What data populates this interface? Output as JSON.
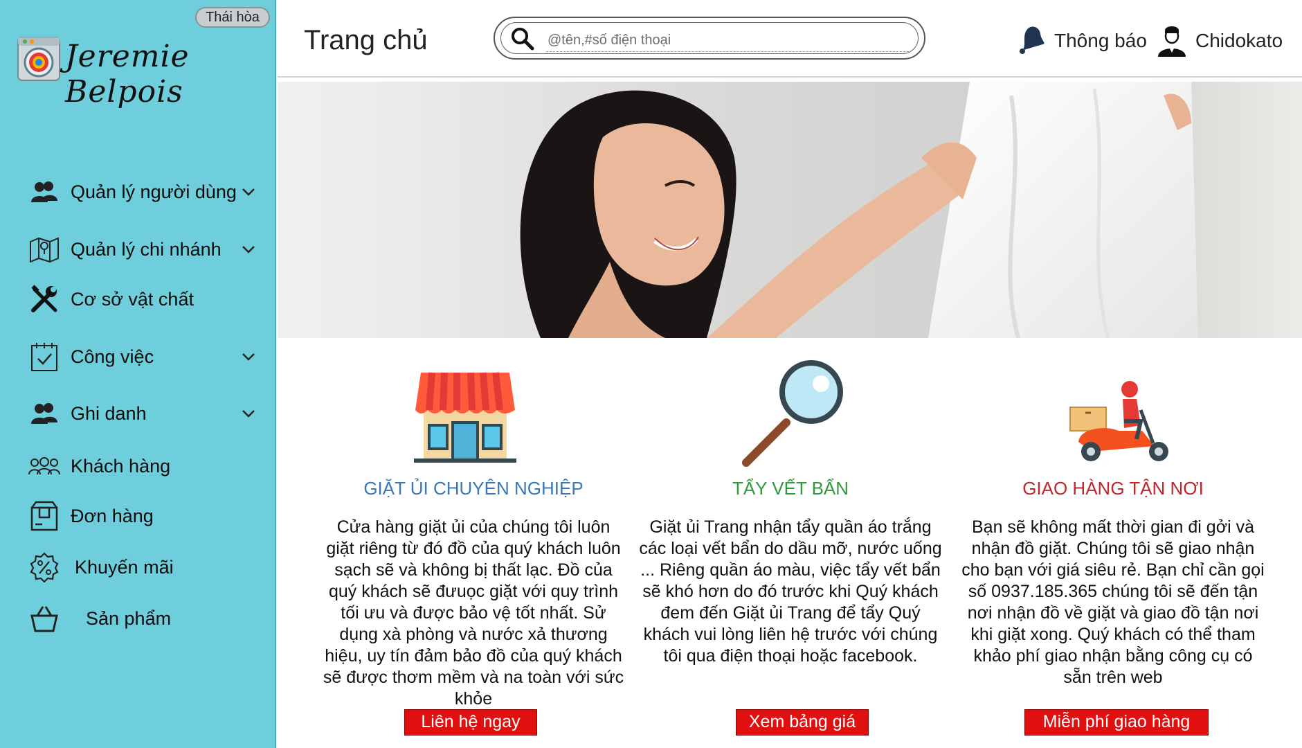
{
  "sidebar": {
    "branch_badge": "Thái hòa",
    "brand_name": "Jeremie Belpois",
    "items": [
      {
        "label": "Quản lý người dùng",
        "icon": "users-icon",
        "has_dropdown": true
      },
      {
        "label": "Quản lý chi nhánh",
        "icon": "map-icon",
        "has_dropdown": true
      },
      {
        "label": "Cơ sở vật chất",
        "icon": "tools-icon",
        "has_dropdown": false
      },
      {
        "label": "Công việc",
        "icon": "calendar-check-icon",
        "has_dropdown": true
      },
      {
        "label": "Ghi danh",
        "icon": "users-icon",
        "has_dropdown": true
      },
      {
        "label": "Khách hàng",
        "icon": "customers-icon",
        "has_dropdown": false
      },
      {
        "label": "Đơn hàng",
        "icon": "package-icon",
        "has_dropdown": false
      },
      {
        "label": "Khuyến mãi",
        "icon": "discount-icon",
        "has_dropdown": false
      },
      {
        "label": "Sản phẩm",
        "icon": "basket-icon",
        "has_dropdown": false
      }
    ]
  },
  "header": {
    "title": "Trang chủ",
    "search_placeholder": "@tên,#số điện thoại",
    "notifications_label": "Thông báo",
    "user_name": "Chidokato"
  },
  "features": [
    {
      "title": "GIẶT ỦI CHUYÊN NGHIỆP",
      "title_color": "#3a78b5",
      "icon": "storefront-icon",
      "description": "Cửa hàng giặt ủi của chúng tôi luôn giặt riêng từ đó đồ của quý khách luôn sạch sẽ và không bị thất lạc. Đồ của quý khách sẽ đưuọc giặt với quy trình tối ưu và được bảo vệ tốt nhất. Sử dụng xà phòng và nước xả thương hiệu, uy tín đảm bảo đồ của quý khách sẽ được thơm mềm và na toàn với sức khỏe",
      "button": "Liên hệ ngay"
    },
    {
      "title": "TẨY VẾT BẨN",
      "title_color": "#2f9a3c",
      "icon": "magnifier-icon",
      "description": "Giặt ủi Trang nhận tẩy quần áo trắng các loại vết bẩn do dầu mỡ, nước uống ... Riêng quần áo màu, việc tẩy vết bẩn sẽ khó hơn do đó trước khi Quý khách đem đến Giặt ủi Trang để tẩy Quý khách vui lòng liên hệ trước với chúng tôi qua điện thoại hoặc facebook.",
      "button": "Xem bảng giá"
    },
    {
      "title": "GIAO HÀNG TẬN NƠI",
      "title_color": "#c0262d",
      "icon": "delivery-scooter-icon",
      "description": "Bạn sẽ không mất thời gian đi gởi và nhận đồ giặt. Chúng tôi sẽ giao nhận cho bạn với giá siêu rẻ. Bạn chỉ cần gọi số 0937.185.365 chúng tôi sẽ đến tận nơi nhận đồ về giặt và giao đồ tận nơi khi giặt xong. Quý khách có thể tham khảo phí giao nhận bằng công cụ có sẵn trên web",
      "button": "Miễn phí giao hàng"
    }
  ],
  "colors": {
    "sidebar_bg": "#6ecedb",
    "button_red": "#e01010"
  }
}
